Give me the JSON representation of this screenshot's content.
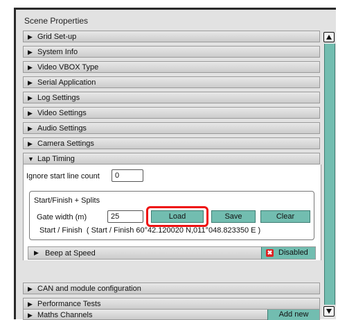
{
  "panel": {
    "title": "Scene Properties"
  },
  "sections": [
    {
      "label": "Grid Set-up",
      "icon": "triangle-right-icon"
    },
    {
      "label": "System Info",
      "icon": "triangle-right-icon"
    },
    {
      "label": "Video VBOX Type",
      "icon": "triangle-right-icon"
    },
    {
      "label": "Serial Application",
      "icon": "triangle-right-icon"
    },
    {
      "label": "Log Settings",
      "icon": "triangle-right-icon"
    },
    {
      "label": "Video Settings",
      "icon": "triangle-right-icon"
    },
    {
      "label": "Audio Settings",
      "icon": "triangle-right-icon"
    },
    {
      "label": "Camera Settings",
      "icon": "triangle-right-icon"
    },
    {
      "label": "Lap Timing",
      "icon": "triangle-down-icon"
    },
    {
      "label": "CAN and module configuration",
      "icon": "triangle-right-icon"
    },
    {
      "label": "Performance Tests",
      "icon": "triangle-right-icon"
    },
    {
      "label": "Maths Channels",
      "icon": "triangle-right-icon"
    }
  ],
  "lap_timing": {
    "ignore_label": "Ignore start line count",
    "ignore_value": "0",
    "group_title": "Start/Finish + Splits",
    "gate_label": "Gate width (m)",
    "gate_value": "25",
    "load_label": "Load",
    "save_label": "Save",
    "clear_label": "Clear",
    "start_finish_text": "Start / Finish  ( Start / Finish 60°42.120020 N,011°048.823350 E )",
    "beep_label": "Beep at Speed",
    "beep_status": "Disabled"
  },
  "maths": {
    "add_label": "Add new"
  },
  "colors": {
    "accent": "#72bdb0",
    "highlight": "#ee1111",
    "disabled_icon": "#dd2222"
  }
}
